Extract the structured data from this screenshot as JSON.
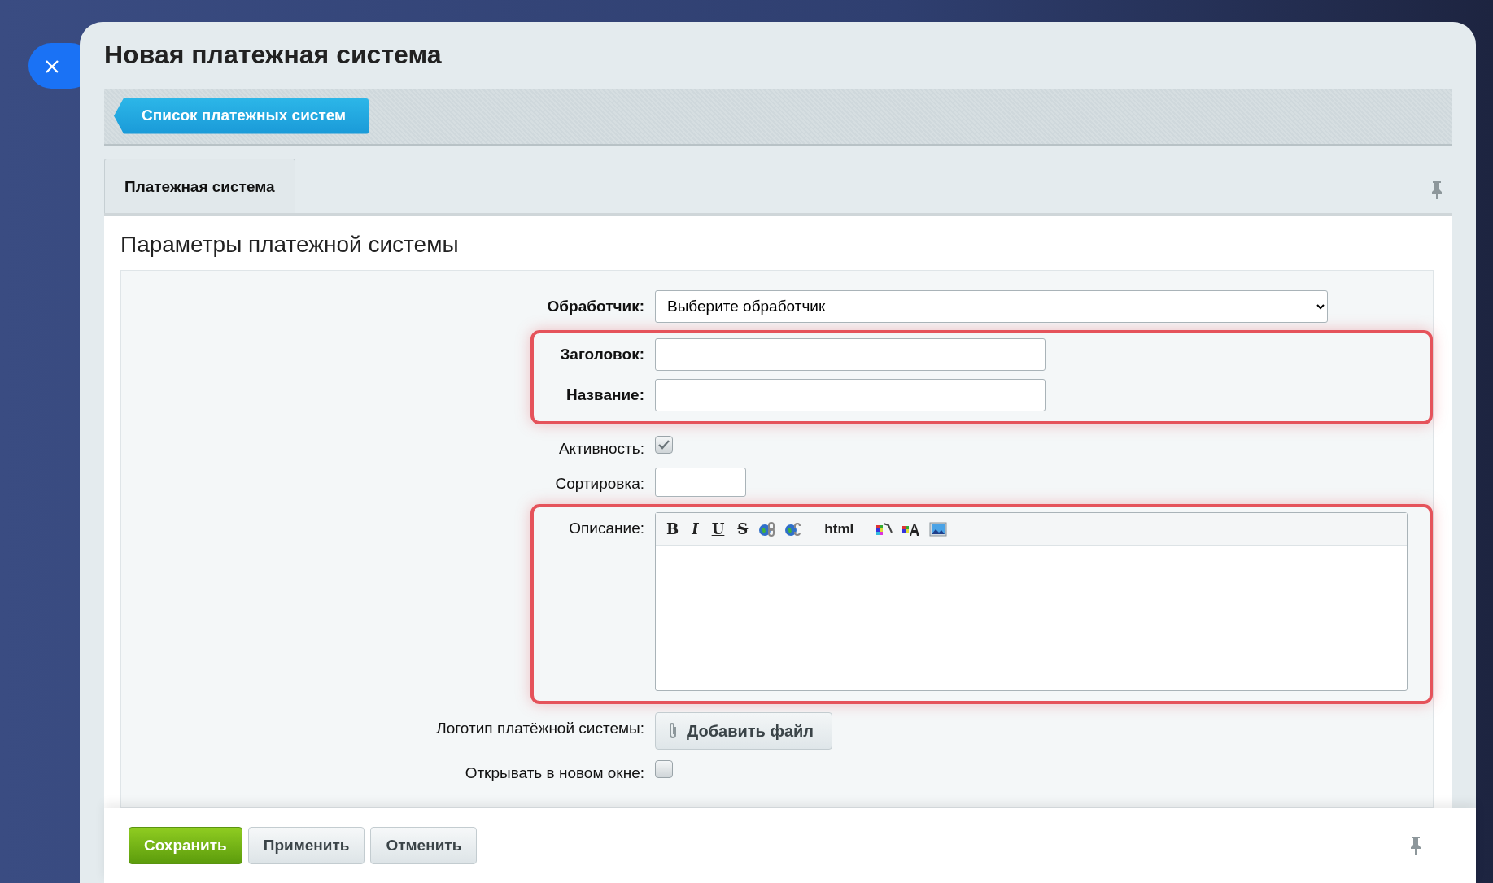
{
  "title": "Новая платежная система",
  "breadcrumb": {
    "label": "Список платежных систем"
  },
  "tabs": [
    {
      "label": "Платежная система",
      "selected": true
    }
  ],
  "section_title": "Параметры платежной системы",
  "rows": [
    {
      "kind": "select",
      "label": "Обработчик:",
      "required": true,
      "highlighted": false,
      "value": "Выберите обработчик"
    },
    {
      "kind": "text",
      "label": "Заголовок:",
      "required": true,
      "highlighted": true
    },
    {
      "kind": "text",
      "label": "Название:",
      "required": true,
      "highlighted": true
    },
    {
      "kind": "checkbox",
      "label": "Активность:",
      "required": false,
      "highlighted": false,
      "checked": true
    },
    {
      "kind": "short",
      "label": "Сортировка:",
      "required": false,
      "highlighted": false
    },
    {
      "kind": "editor",
      "label": "Описание:",
      "required": false,
      "highlighted": true
    },
    {
      "kind": "file",
      "label": "Логотип платёжной системы:",
      "required": false,
      "highlighted": false,
      "button": "Добавить файл"
    },
    {
      "kind": "checkbox",
      "label": "Открывать в новом окне:",
      "required": false,
      "highlighted": false,
      "checked": false
    }
  ],
  "editor_toolbar": [
    {
      "kind": "bold",
      "label": "B"
    },
    {
      "kind": "italic",
      "label": "I"
    },
    {
      "kind": "underline",
      "label": "U"
    },
    {
      "kind": "strike",
      "label": "S"
    },
    {
      "kind": "link"
    },
    {
      "kind": "unlink"
    },
    {
      "kind": "html",
      "label": "html"
    },
    {
      "kind": "palette"
    },
    {
      "kind": "fontcolor"
    },
    {
      "kind": "image"
    }
  ],
  "footer_buttons": [
    {
      "label": "Сохранить",
      "kind": "primary"
    },
    {
      "label": "Применить",
      "kind": "default"
    },
    {
      "label": "Отменить",
      "kind": "default"
    }
  ]
}
